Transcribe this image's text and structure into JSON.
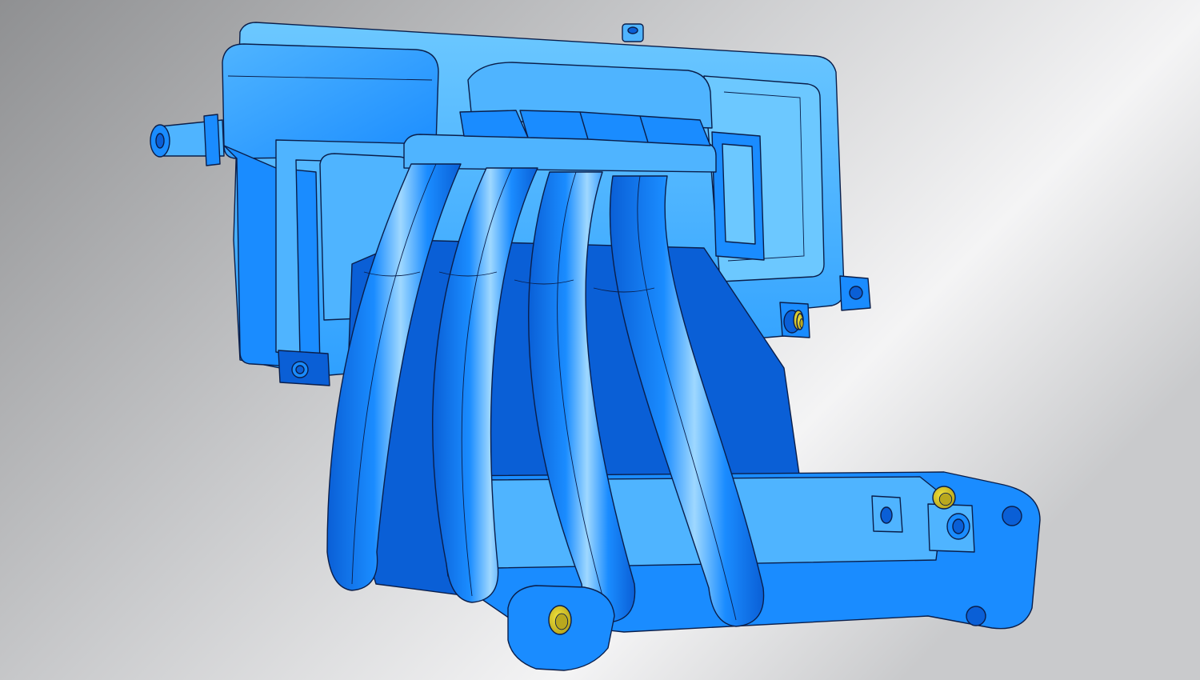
{
  "viewport": {
    "background_colors": {
      "dark": "#8f9092",
      "mid": "#c9cacc",
      "light": "#f4f4f5"
    }
  },
  "model": {
    "icon": "intake-manifold-3d-model",
    "colors": {
      "body": "#1a8cff",
      "body_shade": "#0a5fd6",
      "body_light": "#4fb4ff",
      "body_highlight": "#9fd8ff",
      "plenum": "#2fa0ff",
      "plenum_light": "#6cc8ff",
      "edge": "#0a1e4a",
      "bushing": "#f2e33c",
      "bushing_shade": "#b9a81e"
    },
    "runner_count": 4,
    "bushing_count": 4
  }
}
